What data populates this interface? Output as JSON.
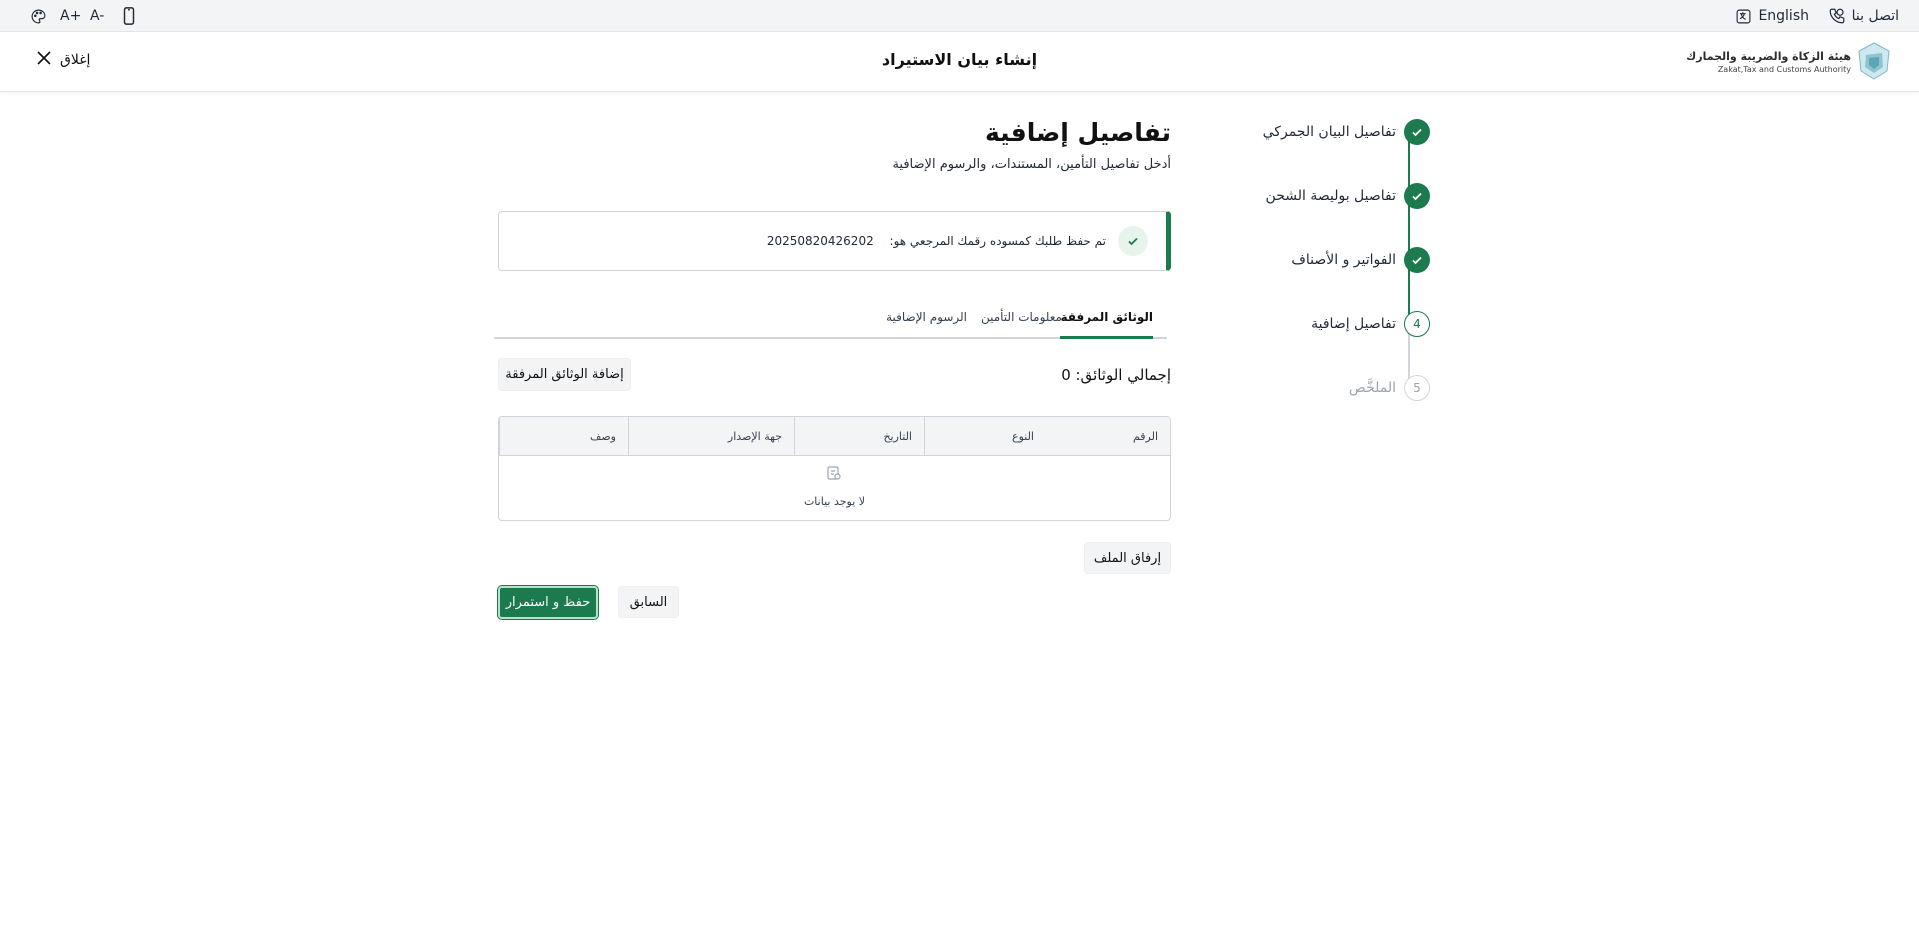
{
  "topbar": {
    "contact_label": "اتصل بنا",
    "language_label": "English",
    "font_increase": "A+",
    "font_decrease": "A-"
  },
  "header": {
    "close_label": "إغلاق",
    "title": "إنشاء بيان الاستيراد",
    "logo_ar": "هيئة الزكاة والضريبة والجمارك",
    "logo_en": "Zakat,Tax and Customs Authority"
  },
  "stepper": {
    "steps": [
      {
        "label": "تفاصيل البيان الجمركي",
        "state": "done"
      },
      {
        "label": "تفاصيل بوليصة الشحن",
        "state": "done"
      },
      {
        "label": "الفواتير و الأصناف",
        "state": "done"
      },
      {
        "label": "تفاصيل إضافية",
        "state": "current",
        "number": "4"
      },
      {
        "label": "الملخَّص",
        "state": "pending",
        "number": "5"
      }
    ]
  },
  "main": {
    "title": "تفاصيل إضافية",
    "subtitle": "أدخل تفاصيل التأمين، المستندات، والرسوم الإضافية",
    "alert": {
      "message": "تم حفظ طلبك كمسوده رقمك المرجعي هو:",
      "reference": "20250820426202"
    },
    "tabs": [
      {
        "label": "الوثائق المرفقة",
        "active": true
      },
      {
        "label": "معلومات التأمين",
        "active": false
      },
      {
        "label": "الرسوم الإضافية",
        "active": false
      }
    ],
    "total_label": "إجمالي الوثائق: 0",
    "add_documents_label": "إضافة الوثائق المرفقة",
    "table": {
      "columns": [
        "الرقم",
        "النوع",
        "التاريخ",
        "جهة الإصدار",
        "وصف"
      ],
      "empty_text": "لا يوجد بيانات"
    },
    "attach_file_label": "إرفاق الملف",
    "previous_label": "السابق",
    "save_continue_label": "حفظ و استمرار"
  },
  "colors": {
    "brand_green": "#1b7a4e",
    "pending_gray": "#d1d5db"
  }
}
